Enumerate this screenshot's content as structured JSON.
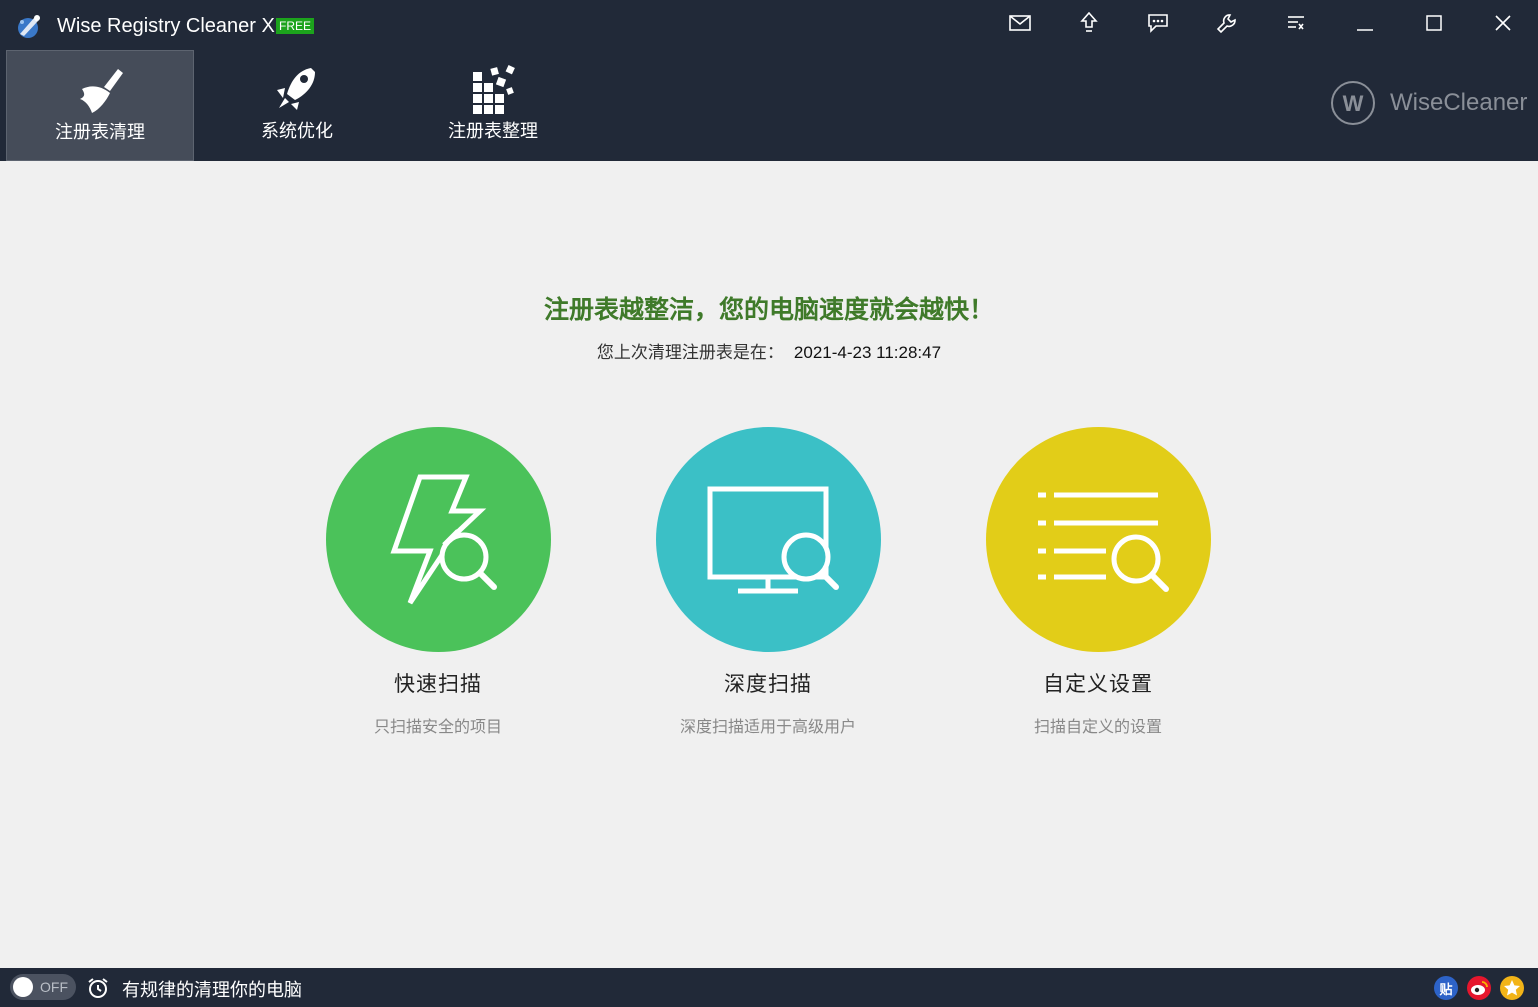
{
  "window": {
    "title": "Wise Registry Cleaner X",
    "badge": "FREE"
  },
  "titlebar_buttons": [
    "mail-icon",
    "upgrade-icon",
    "feedback-icon",
    "settings-icon",
    "menu-icon",
    "minimize-icon",
    "maximize-icon",
    "close-icon"
  ],
  "nav": {
    "tabs": [
      {
        "label": "注册表清理",
        "icon": "broom-icon",
        "active": true
      },
      {
        "label": "系统优化",
        "icon": "rocket-icon",
        "active": false
      },
      {
        "label": "注册表整理",
        "icon": "defrag-icon",
        "active": false
      }
    ]
  },
  "brand": {
    "logo_letter": "W",
    "name": "WiseCleaner"
  },
  "main": {
    "headline": "注册表越整洁，您的电脑速度就会越快！",
    "last_clean_label": "您上次清理注册表是在：",
    "last_clean_value": "2021-4-23 11:28:47",
    "scans": [
      {
        "title": "快速扫描",
        "desc": "只扫描安全的项目",
        "icon": "fast-scan-icon",
        "color": "#4bc25a"
      },
      {
        "title": "深度扫描",
        "desc": "深度扫描适用于高级用户",
        "icon": "deep-scan-icon",
        "color": "#3bc0c6"
      },
      {
        "title": "自定义设置",
        "desc": "扫描自定义的设置",
        "icon": "custom-scan-icon",
        "color": "#e2cd18"
      }
    ]
  },
  "footer": {
    "toggle_state": "OFF",
    "schedule_text": "有规律的清理你的电脑",
    "social": [
      {
        "icon": "tieba-icon",
        "glyph": "贴",
        "color": "#2d63c8"
      },
      {
        "icon": "weibo-icon",
        "glyph": "",
        "color": "#e6162d"
      },
      {
        "icon": "favorite-icon",
        "glyph": "",
        "color": "#f2b418"
      }
    ]
  }
}
